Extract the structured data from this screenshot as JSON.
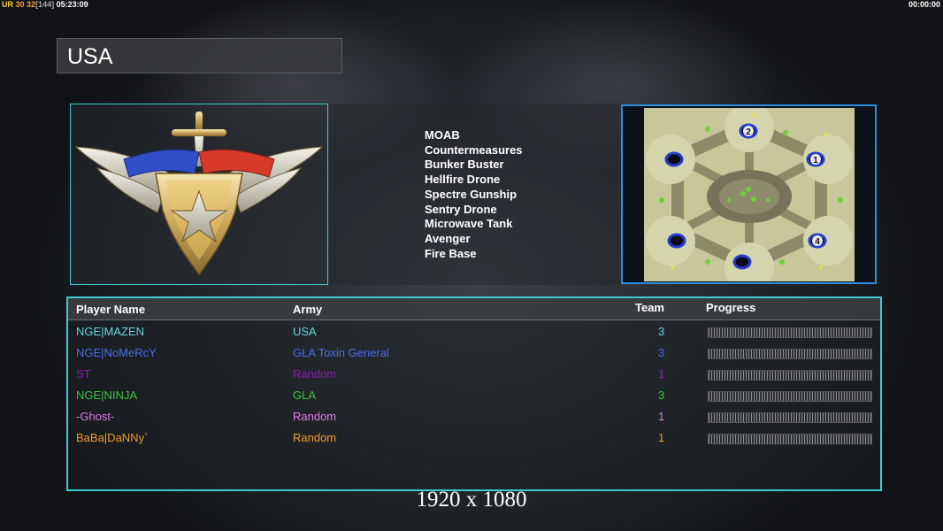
{
  "status_bar": {
    "left": {
      "a": "UR",
      "b": "30",
      "c": "32",
      "d": "[144]",
      "time": "05:23:09"
    },
    "right_timer": "00:00:00"
  },
  "faction": {
    "name": "USA"
  },
  "general_powers": [
    "MOAB",
    "Countermeasures",
    "Bunker Buster",
    "Hellfire Drone",
    "Spectre Gunship",
    "Sentry Drone",
    "Microwave Tank",
    "Avenger",
    "Fire Base"
  ],
  "map": {
    "start_positions": [
      "2",
      "1",
      "4"
    ]
  },
  "table": {
    "headers": {
      "player": "Player Name",
      "army": "Army",
      "team": "Team",
      "progress": "Progress"
    },
    "rows": [
      {
        "player": "NGE|MAZEN",
        "army": "USA",
        "team": "3",
        "color": "#5fd6e8"
      },
      {
        "player": "NGE|NoMeRcY",
        "army": "GLA Toxin General",
        "team": "3",
        "color": "#4a6cf0"
      },
      {
        "player": "ST",
        "army": "Random",
        "team": "1",
        "color": "#8a1fb8"
      },
      {
        "player": "NGE|NINJA",
        "army": "GLA",
        "team": "3",
        "color": "#3fc23f"
      },
      {
        "player": "-Ghost-",
        "army": "Random",
        "team": "1",
        "color": "#e07ee8"
      },
      {
        "player": "BaBa|DaNNy`",
        "army": "Random",
        "team": "1",
        "color": "#f09a2a"
      }
    ]
  },
  "resolution": "1920 x 1080",
  "colors": {
    "table_border": "#3ecbd0",
    "map_border": "#2a8fe0"
  }
}
